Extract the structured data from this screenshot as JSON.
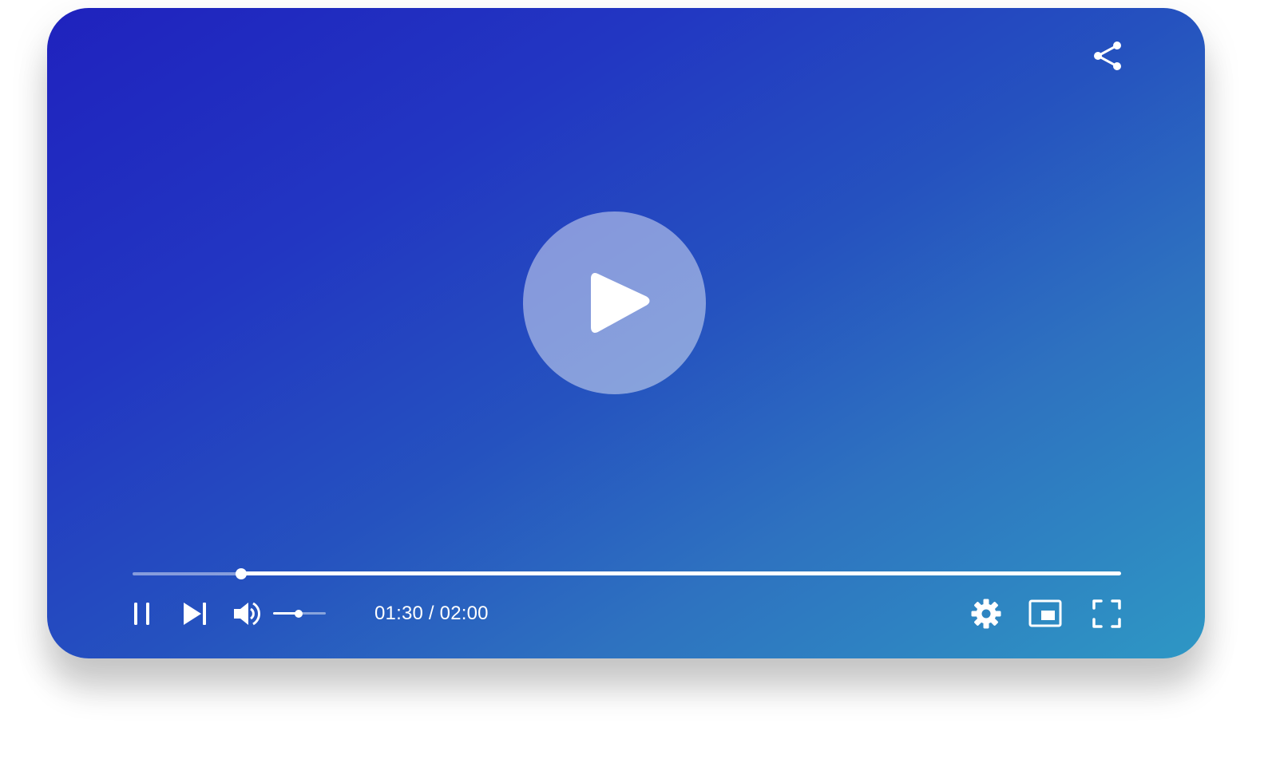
{
  "player": {
    "state": "paused",
    "time": {
      "current": "01:30",
      "duration": "02:00",
      "separator": " / "
    },
    "progress_fraction": 0.11,
    "volume_fraction": 0.48,
    "colors": {
      "gradient_start": "#1f22be",
      "gradient_mid": "#2552bf",
      "gradient_end": "#2e97c4",
      "foreground": "#ffffff"
    },
    "icons": {
      "share": "share-icon",
      "big_play": "play-icon",
      "pause": "pause-icon",
      "next": "skip-next-icon",
      "volume": "volume-up-icon",
      "settings": "gear-icon",
      "miniplayer": "picture-in-picture-icon",
      "fullscreen": "fullscreen-icon"
    }
  }
}
